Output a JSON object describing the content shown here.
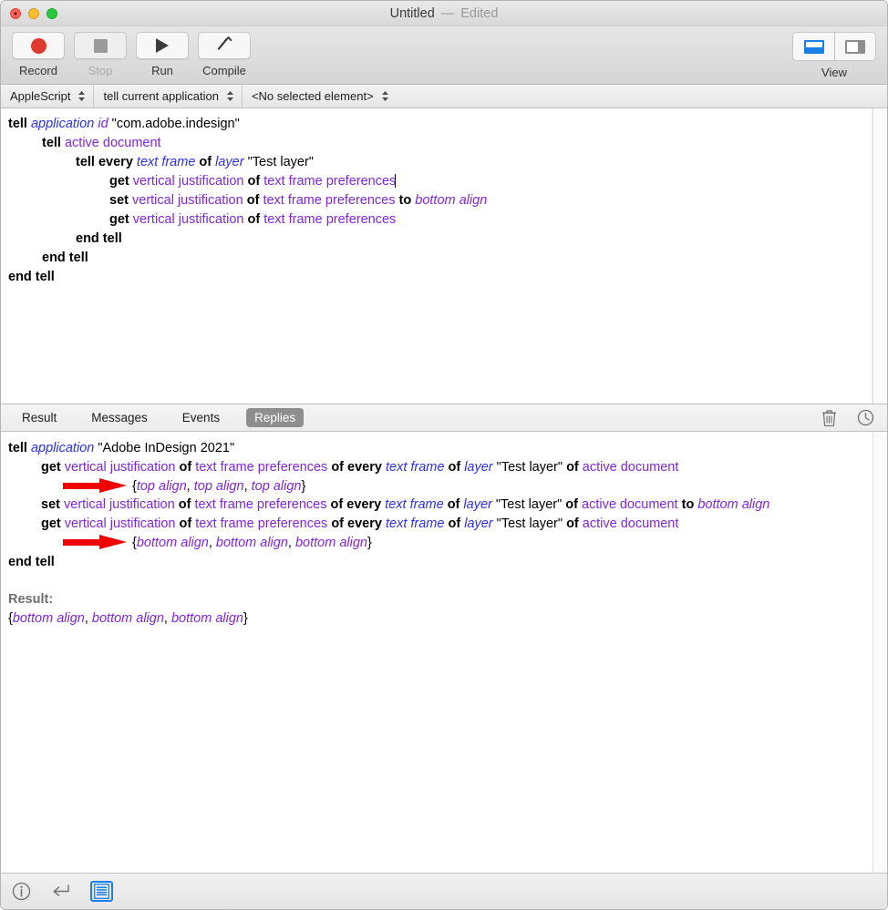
{
  "window": {
    "title": "Untitled",
    "dash": "—",
    "edited": "Edited"
  },
  "toolbar": {
    "record_label": "Record",
    "stop_label": "Stop",
    "run_label": "Run",
    "compile_label": "Compile",
    "view_label": "View"
  },
  "navbar": {
    "language": "AppleScript",
    "target": "tell current application",
    "element": "<No selected element>"
  },
  "script": {
    "lines": [
      {
        "indent": 0,
        "tokens": [
          {
            "t": "tell",
            "c": "kw"
          },
          {
            "t": " ",
            "c": "plain"
          },
          {
            "t": "application",
            "c": "blu"
          },
          {
            "t": " ",
            "c": "plain"
          },
          {
            "t": "id",
            "c": "puri"
          },
          {
            "t": " ",
            "c": "plain"
          },
          {
            "t": "\"com.adobe.indesign\"",
            "c": "str"
          }
        ]
      },
      {
        "indent": 1,
        "tokens": [
          {
            "t": "tell",
            "c": "kw"
          },
          {
            "t": " ",
            "c": "plain"
          },
          {
            "t": "active document",
            "c": "pur"
          }
        ]
      },
      {
        "indent": 2,
        "tokens": [
          {
            "t": "tell every",
            "c": "kw"
          },
          {
            "t": " ",
            "c": "plain"
          },
          {
            "t": "text frame",
            "c": "blu"
          },
          {
            "t": " ",
            "c": "plain"
          },
          {
            "t": "of",
            "c": "kw"
          },
          {
            "t": " ",
            "c": "plain"
          },
          {
            "t": "layer",
            "c": "blu"
          },
          {
            "t": " ",
            "c": "plain"
          },
          {
            "t": "\"Test layer\"",
            "c": "str"
          }
        ]
      },
      {
        "indent": 3,
        "tokens": [
          {
            "t": "get",
            "c": "kw"
          },
          {
            "t": " ",
            "c": "plain"
          },
          {
            "t": "vertical justification",
            "c": "pur"
          },
          {
            "t": " ",
            "c": "plain"
          },
          {
            "t": "of",
            "c": "kw"
          },
          {
            "t": " ",
            "c": "plain"
          },
          {
            "t": "text frame preferences",
            "c": "pur"
          },
          {
            "t": "",
            "c": "caret"
          }
        ]
      },
      {
        "indent": 3,
        "tokens": [
          {
            "t": "set",
            "c": "kw"
          },
          {
            "t": " ",
            "c": "plain"
          },
          {
            "t": "vertical justification",
            "c": "pur"
          },
          {
            "t": " ",
            "c": "plain"
          },
          {
            "t": "of",
            "c": "kw"
          },
          {
            "t": " ",
            "c": "plain"
          },
          {
            "t": "text frame preferences",
            "c": "pur"
          },
          {
            "t": " ",
            "c": "plain"
          },
          {
            "t": "to",
            "c": "kw"
          },
          {
            "t": " ",
            "c": "plain"
          },
          {
            "t": "bottom align",
            "c": "puri"
          }
        ]
      },
      {
        "indent": 3,
        "tokens": [
          {
            "t": "get",
            "c": "kw"
          },
          {
            "t": " ",
            "c": "plain"
          },
          {
            "t": "vertical justification",
            "c": "pur"
          },
          {
            "t": " ",
            "c": "plain"
          },
          {
            "t": "of",
            "c": "kw"
          },
          {
            "t": " ",
            "c": "plain"
          },
          {
            "t": "text frame preferences",
            "c": "pur"
          }
        ]
      },
      {
        "indent": 2,
        "tokens": [
          {
            "t": "end tell",
            "c": "kw"
          }
        ]
      },
      {
        "indent": 1,
        "tokens": [
          {
            "t": "end tell",
            "c": "kw"
          }
        ]
      },
      {
        "indent": 0,
        "tokens": [
          {
            "t": "end tell",
            "c": "kw"
          }
        ]
      }
    ]
  },
  "results": {
    "tabs": [
      {
        "label": "Result",
        "active": false
      },
      {
        "label": "Messages",
        "active": false
      },
      {
        "label": "Events",
        "active": false
      },
      {
        "label": "Replies",
        "active": true
      }
    ],
    "icons": [
      {
        "name": "trash-icon"
      },
      {
        "name": "history-clock-icon"
      }
    ],
    "lines": [
      {
        "indent": 0,
        "arrow": false,
        "tokens": [
          {
            "t": "tell",
            "c": "kw"
          },
          {
            "t": " ",
            "c": "plain"
          },
          {
            "t": "application",
            "c": "blu"
          },
          {
            "t": " ",
            "c": "plain"
          },
          {
            "t": "\"Adobe InDesign 2021\"",
            "c": "str"
          }
        ]
      },
      {
        "indent": 1,
        "arrow": false,
        "tokens": [
          {
            "t": "get",
            "c": "kw"
          },
          {
            "t": " ",
            "c": "plain"
          },
          {
            "t": "vertical justification",
            "c": "pur"
          },
          {
            "t": " ",
            "c": "plain"
          },
          {
            "t": "of",
            "c": "kw"
          },
          {
            "t": " ",
            "c": "plain"
          },
          {
            "t": "text frame preferences",
            "c": "pur"
          },
          {
            "t": " ",
            "c": "plain"
          },
          {
            "t": "of every",
            "c": "kw"
          },
          {
            "t": " ",
            "c": "plain"
          },
          {
            "t": "text frame",
            "c": "blu"
          },
          {
            "t": " ",
            "c": "plain"
          },
          {
            "t": "of",
            "c": "kw"
          },
          {
            "t": " ",
            "c": "plain"
          },
          {
            "t": "layer",
            "c": "blu"
          },
          {
            "t": " ",
            "c": "plain"
          },
          {
            "t": "\"Test layer\"",
            "c": "str"
          },
          {
            "t": " ",
            "c": "plain"
          },
          {
            "t": "of",
            "c": "kw"
          },
          {
            "t": " ",
            "c": "plain"
          },
          {
            "t": "active document",
            "c": "pur"
          }
        ]
      },
      {
        "indent": 2,
        "arrow": true,
        "tokens": [
          {
            "t": "{",
            "c": "str"
          },
          {
            "t": "top align",
            "c": "puri"
          },
          {
            "t": ", ",
            "c": "str"
          },
          {
            "t": "top align",
            "c": "puri"
          },
          {
            "t": ", ",
            "c": "str"
          },
          {
            "t": "top align",
            "c": "puri"
          },
          {
            "t": "}",
            "c": "str"
          }
        ]
      },
      {
        "indent": 1,
        "arrow": false,
        "tokens": [
          {
            "t": "set",
            "c": "kw"
          },
          {
            "t": " ",
            "c": "plain"
          },
          {
            "t": "vertical justification",
            "c": "pur"
          },
          {
            "t": " ",
            "c": "plain"
          },
          {
            "t": "of",
            "c": "kw"
          },
          {
            "t": " ",
            "c": "plain"
          },
          {
            "t": "text frame preferences",
            "c": "pur"
          },
          {
            "t": " ",
            "c": "plain"
          },
          {
            "t": "of every",
            "c": "kw"
          },
          {
            "t": " ",
            "c": "plain"
          },
          {
            "t": "text frame",
            "c": "blu"
          },
          {
            "t": " ",
            "c": "plain"
          },
          {
            "t": "of",
            "c": "kw"
          },
          {
            "t": " ",
            "c": "plain"
          },
          {
            "t": "layer",
            "c": "blu"
          },
          {
            "t": " ",
            "c": "plain"
          },
          {
            "t": "\"Test layer\"",
            "c": "str"
          },
          {
            "t": " ",
            "c": "plain"
          },
          {
            "t": "of",
            "c": "kw"
          },
          {
            "t": " ",
            "c": "plain"
          },
          {
            "t": "active document",
            "c": "pur"
          },
          {
            "t": " ",
            "c": "plain"
          },
          {
            "t": "to",
            "c": "kw"
          },
          {
            "t": " ",
            "c": "plain"
          },
          {
            "t": "bottom align",
            "c": "puri"
          }
        ]
      },
      {
        "indent": 1,
        "arrow": false,
        "tokens": [
          {
            "t": "get",
            "c": "kw"
          },
          {
            "t": " ",
            "c": "plain"
          },
          {
            "t": "vertical justification",
            "c": "pur"
          },
          {
            "t": " ",
            "c": "plain"
          },
          {
            "t": "of",
            "c": "kw"
          },
          {
            "t": " ",
            "c": "plain"
          },
          {
            "t": "text frame preferences",
            "c": "pur"
          },
          {
            "t": " ",
            "c": "plain"
          },
          {
            "t": "of every",
            "c": "kw"
          },
          {
            "t": " ",
            "c": "plain"
          },
          {
            "t": "text frame",
            "c": "blu"
          },
          {
            "t": " ",
            "c": "plain"
          },
          {
            "t": "of",
            "c": "kw"
          },
          {
            "t": " ",
            "c": "plain"
          },
          {
            "t": "layer",
            "c": "blu"
          },
          {
            "t": " ",
            "c": "plain"
          },
          {
            "t": "\"Test layer\"",
            "c": "str"
          },
          {
            "t": " ",
            "c": "plain"
          },
          {
            "t": "of",
            "c": "kw"
          },
          {
            "t": " ",
            "c": "plain"
          },
          {
            "t": "active document",
            "c": "pur"
          }
        ]
      },
      {
        "indent": 2,
        "arrow": true,
        "tokens": [
          {
            "t": "{",
            "c": "str"
          },
          {
            "t": "bottom align",
            "c": "puri"
          },
          {
            "t": ", ",
            "c": "str"
          },
          {
            "t": "bottom align",
            "c": "puri"
          },
          {
            "t": ", ",
            "c": "str"
          },
          {
            "t": "bottom align",
            "c": "puri"
          },
          {
            "t": "}",
            "c": "str"
          }
        ]
      },
      {
        "indent": 0,
        "arrow": false,
        "tokens": [
          {
            "t": "end tell",
            "c": "kw"
          }
        ]
      },
      {
        "indent": 0,
        "arrow": false,
        "blank": true,
        "tokens": []
      },
      {
        "indent": 0,
        "arrow": false,
        "tokens": [
          {
            "t": "Result:",
            "c": "gray"
          }
        ]
      },
      {
        "indent": 0,
        "arrow": false,
        "tokens": [
          {
            "t": "{",
            "c": "str"
          },
          {
            "t": "bottom align",
            "c": "puri"
          },
          {
            "t": ", ",
            "c": "str"
          },
          {
            "t": "bottom align",
            "c": "puri"
          },
          {
            "t": ", ",
            "c": "str"
          },
          {
            "t": "bottom align",
            "c": "puri"
          },
          {
            "t": "}",
            "c": "str"
          }
        ]
      }
    ]
  },
  "statusbar": {
    "icons": [
      {
        "name": "info-icon",
        "selected": false
      },
      {
        "name": "return-arrow-icon",
        "selected": false
      },
      {
        "name": "lines-list-icon",
        "selected": true
      }
    ]
  },
  "colors": {
    "keyword": "#000000",
    "class_blue": "#2a2ff0",
    "property_purple": "#7f26e0",
    "result_gray": "#6e6e6e",
    "annotation_red": "#f00000",
    "accent_blue": "#1b7fe8",
    "tab_active_bg": "#8e8e8e"
  }
}
